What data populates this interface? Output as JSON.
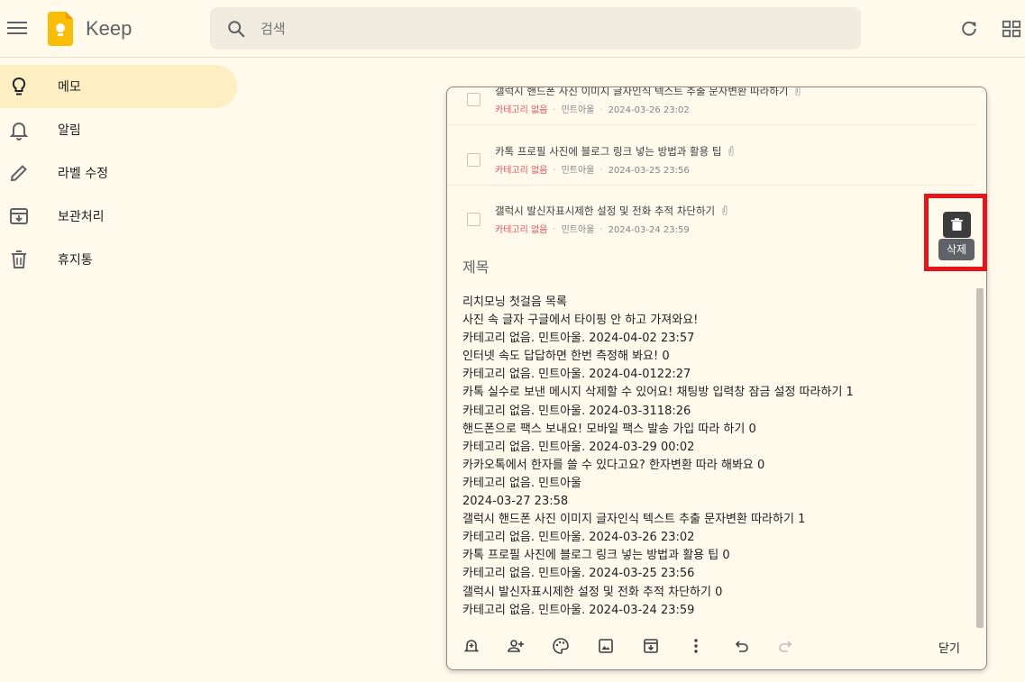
{
  "app": {
    "title": "Keep"
  },
  "search": {
    "placeholder": "검색"
  },
  "sidebar": {
    "items": [
      {
        "label": "메모",
        "icon": "lightbulb-icon",
        "active": true
      },
      {
        "label": "알림",
        "icon": "bell-icon",
        "active": false
      },
      {
        "label": "라벨 수정",
        "icon": "pencil-icon",
        "active": false
      },
      {
        "label": "보관처리",
        "icon": "archive-icon",
        "active": false
      },
      {
        "label": "휴지통",
        "icon": "trash-icon",
        "active": false
      }
    ]
  },
  "editor": {
    "list_items": [
      {
        "title": "갤럭시 핸드폰 사진 이미지 글자인식 텍스트 추출 문자변환 따라하기",
        "category": "카테고리 없음",
        "author": "민트아울",
        "date": "2024-03-26 23:02"
      },
      {
        "title": "카톡 프로필 사진에 블로그 링크 넣는 방법과 활용 팁",
        "category": "카테고리 없음",
        "author": "민트아울",
        "date": "2024-03-25 23:56"
      },
      {
        "title": "갤럭시 발신자표시제한 설정 및 전화 추적 차단하기",
        "category": "카테고리 없음",
        "author": "민트아울",
        "date": "2024-03-24 23:59"
      }
    ],
    "title_placeholder": "제목",
    "body_lines": [
      "리치모닝 첫걸음 목록",
      "사진 속 글자 구글에서 타이핑 안 하고 가져와요!",
      "카테고리 없음. 민트아울. 2024-04-02 23:57",
      "인터넷 속도 답답하면 한번 측정해 봐요! 0",
      "카테고리 없음. 민트아울. 2024-04-0122:27",
      "카톡 실수로 보낸 메시지 삭제할 수 있어요! 채팅방 입력창 잠금 설정 따라하기 1",
      "카테고리 없음. 민트아울. 2024-03-3118:26",
      "핸드폰으로 팩스 보내요! 모바일 팩스 발송 가입 따라 하기 0",
      "카테고리 없음. 민트아울. 2024-03-29 00:02",
      "카카오톡에서 한자를 쓸 수 있다고요? 한자변환 따라 해봐요 0",
      "카테고리 없음. 민트아울",
      "2024-03-27 23:58",
      "갤럭시 핸드폰 사진 이미지 글자인식 텍스트 추출 문자변환 따라하기 1",
      "카테고리 없음. 민트아울. 2024-03-26 23:02",
      "카톡 프로필 사진에 블로그 링크 넣는 방법과 활용 팁 0",
      "카테고리 없음. 민트아울. 2024-03-25 23:56",
      "갤럭시 발신자표시제한 설정 및 전화 추적 차단하기 0",
      "카테고리 없음. 민트아울. 2024-03-24 23:59"
    ],
    "close_label": "닫기",
    "toolbar_icons": [
      "remind-icon",
      "collaborator-icon",
      "palette-icon",
      "image-icon",
      "archive-icon",
      "more-icon",
      "undo-icon",
      "redo-icon"
    ]
  },
  "delete": {
    "tooltip": "삭제"
  },
  "colors": {
    "background": "#fffaeb",
    "active_nav": "#feefc3",
    "highlight": "#e8141c",
    "category": "#e8505b"
  }
}
